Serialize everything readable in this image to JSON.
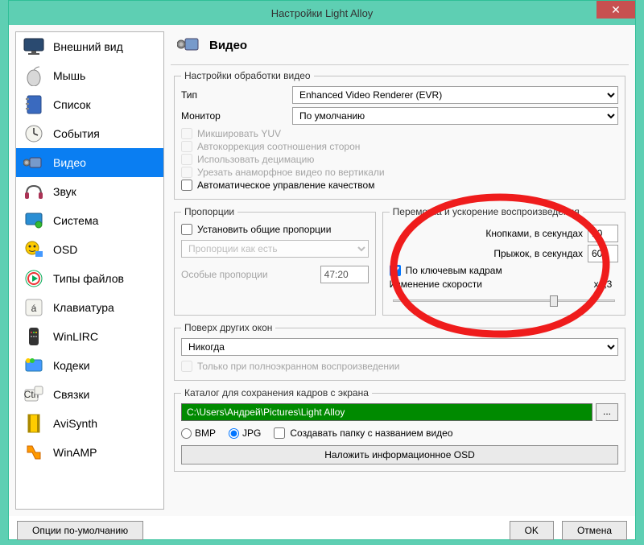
{
  "window": {
    "title": "Настройки Light Alloy"
  },
  "sidebar": {
    "items": [
      {
        "label": "Внешний вид"
      },
      {
        "label": "Мышь"
      },
      {
        "label": "Список"
      },
      {
        "label": "События"
      },
      {
        "label": "Видео",
        "selected": true
      },
      {
        "label": "Звук"
      },
      {
        "label": "Система"
      },
      {
        "label": "OSD"
      },
      {
        "label": "Типы файлов"
      },
      {
        "label": "Клавиатура"
      },
      {
        "label": "WinLIRC"
      },
      {
        "label": "Кодеки"
      },
      {
        "label": "Связки"
      },
      {
        "label": "AviSynth"
      },
      {
        "label": "WinAMP"
      }
    ],
    "defaults_button": "Опции по-умолчанию"
  },
  "header": {
    "title": "Видео"
  },
  "processing": {
    "legend": "Настройки обработки видео",
    "type_label": "Тип",
    "type_value": "Enhanced Video Renderer (EVR)",
    "monitor_label": "Монитор",
    "monitor_value": "По умолчанию",
    "mix_yuv": "Микшировать YUV",
    "autocorrect_ar": "Автокоррекция соотношения сторон",
    "use_decimation": "Использовать децимацию",
    "crop_anamorphic": "Урезать анаморфное видео по вертикали",
    "auto_quality": "Автоматическое управление качеством"
  },
  "proportions": {
    "legend": "Пропорции",
    "set_common": "Установить общие пропорции",
    "keep_as_is": "Пропорции как есть",
    "custom_label": "Особые пропорции",
    "custom_value": "47:20"
  },
  "seek": {
    "legend": "Перемотка и ускорение воспроизведения",
    "buttons_label": "Кнопками, в секундах",
    "buttons_value": "10",
    "jump_label": "Прыжок, в секундах",
    "jump_value": "60",
    "keyframes": "По ключевым кадрам",
    "speed_label": "Изменение скорости",
    "speed_value": "x1,3"
  },
  "ontop": {
    "legend": "Поверх других окон",
    "value": "Никогда",
    "fullscreen_only": "Только при полноэкранном воспроизведении"
  },
  "capture": {
    "legend": "Каталог для сохранения кадров с экрана",
    "path": "C:\\Users\\Андрей\\Pictures\\Light Alloy",
    "browse": "...",
    "bmp": "BMP",
    "jpg": "JPG",
    "create_folder": "Создавать папку с названием видео",
    "overlay_osd": "Наложить информационное OSD"
  },
  "footer": {
    "ok": "OK",
    "cancel": "Отмена"
  }
}
